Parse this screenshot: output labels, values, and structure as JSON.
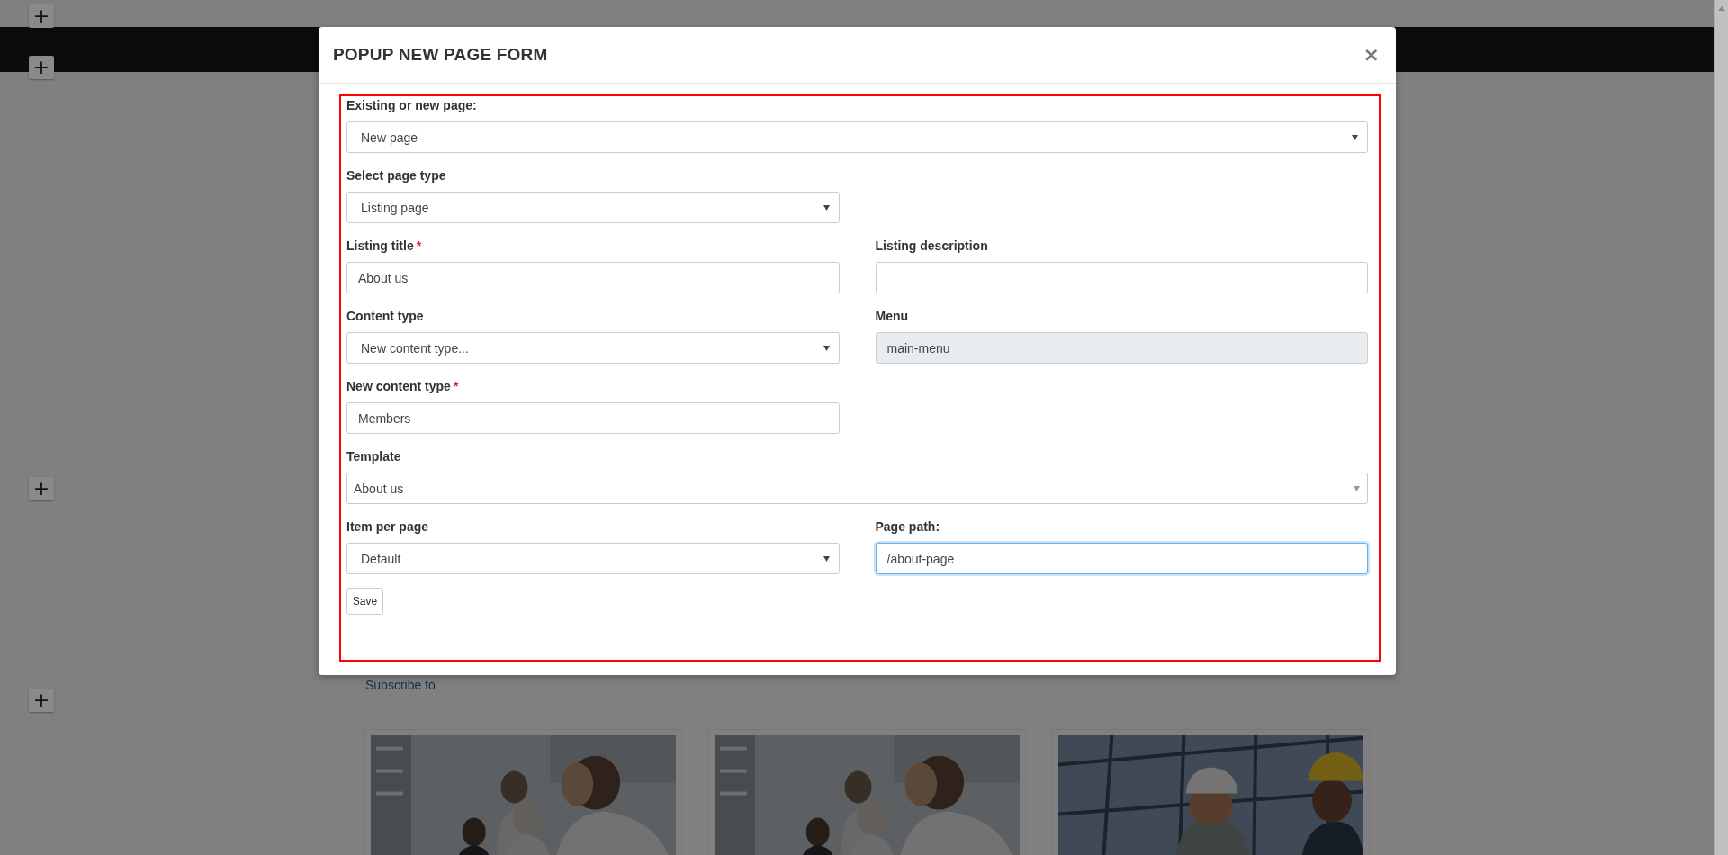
{
  "background": {
    "add_buttons": [
      "+",
      "+",
      "+",
      "+"
    ],
    "link": "Subscribe to"
  },
  "modal": {
    "title": "POPUP NEW PAGE FORM",
    "close": "×",
    "rows": [
      {
        "kind": "wide",
        "fields": [
          {
            "label": "Existing or new page:",
            "kind": "select",
            "value": "New page",
            "disabled": false,
            "focused": false
          }
        ]
      },
      {
        "kind": "split",
        "fields": [
          {
            "label": "Select page type",
            "kind": "select",
            "value": "Listing page",
            "disabled": false,
            "focused": false
          }
        ]
      },
      {
        "kind": "split",
        "fields": [
          {
            "label": "Listing title",
            "required_mark": "*",
            "kind": "input",
            "value": "About us",
            "disabled": false,
            "focused": false
          },
          {
            "label": "Listing description",
            "kind": "input",
            "disabled": false,
            "focused": false
          }
        ]
      },
      {
        "kind": "split",
        "fields": [
          {
            "label": "Content type",
            "kind": "select",
            "value": "New content type...",
            "disabled": false,
            "focused": false
          },
          {
            "label": "Menu",
            "kind": "input",
            "value": "main-menu",
            "disabled": true,
            "focused": false
          }
        ]
      },
      {
        "kind": "split",
        "fields": [
          {
            "label": "New content type",
            "required_mark": "*",
            "kind": "input",
            "value": "Members",
            "disabled": false,
            "focused": false
          }
        ]
      },
      {
        "kind": "wide",
        "fields": [
          {
            "label": "Template",
            "kind": "combobox",
            "value": "About us",
            "disabled": false,
            "focused": false
          }
        ]
      },
      {
        "kind": "split",
        "fields": [
          {
            "label": "Item per page",
            "kind": "select",
            "value": "Default",
            "disabled": false,
            "focused": false
          },
          {
            "label": "Page path:",
            "kind": "input",
            "value": "/about-page",
            "disabled": false,
            "focused": true
          }
        ]
      }
    ],
    "save_button": "Save"
  }
}
